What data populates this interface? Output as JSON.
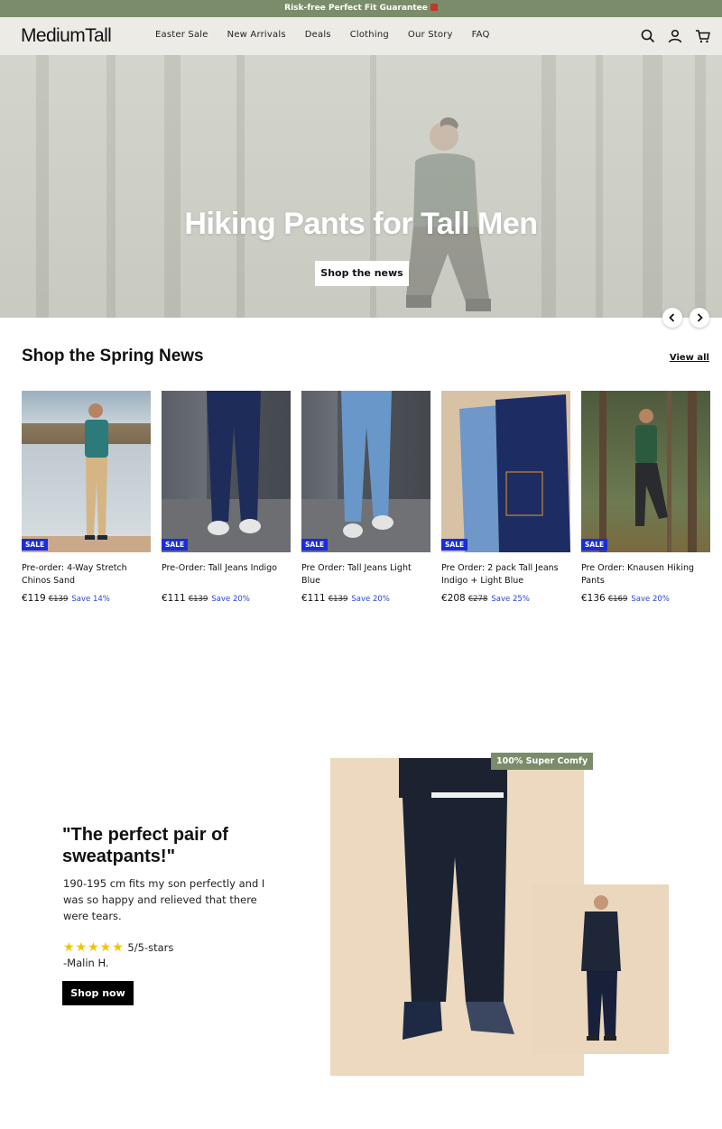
{
  "announcement": {
    "text": "Risk-free Perfect Fit Guarantee"
  },
  "header": {
    "logo": "MediumTall",
    "nav": [
      "Easter Sale",
      "New Arrivals",
      "Deals",
      "Clothing",
      "Our Story",
      "FAQ"
    ],
    "icons": [
      "search-icon",
      "account-icon",
      "cart-icon"
    ]
  },
  "hero": {
    "title": "Hiking Pants for Tall Men",
    "button": "Shop the news"
  },
  "spring": {
    "title": "Shop the Spring News",
    "view_all": "View all",
    "products": [
      {
        "badge": "SALE",
        "name": "Pre-order: 4-Way Stretch Chinos Sand",
        "price": "€119",
        "was": "€139",
        "save": "Save 14%"
      },
      {
        "badge": "SALE",
        "name": "Pre-Order: Tall Jeans Indigo",
        "price": "€111",
        "was": "€139",
        "save": "Save 20%"
      },
      {
        "badge": "SALE",
        "name": "Pre Order: Tall Jeans Light Blue",
        "price": "€111",
        "was": "€139",
        "save": "Save 20%"
      },
      {
        "badge": "SALE",
        "name": "Pre Order: 2 pack Tall Jeans Indigo + Light Blue",
        "price": "€208",
        "was": "€278",
        "save": "Save 25%"
      },
      {
        "badge": "SALE",
        "name": "Pre Order: Knausen Hiking Pants",
        "price": "€136",
        "was": "€169",
        "save": "Save 20%"
      }
    ]
  },
  "testimonial": {
    "quote": "\"The perfect pair of sweatpants!\"",
    "text": "190-195 cm fits my son perfectly and I was so happy and relieved that there were tears.",
    "stars": "★★★★★",
    "rating": "5/5-stars",
    "author": "-Malin H.",
    "button": "Shop now",
    "badge": "100% Super Comfy"
  },
  "colors": {
    "announcement_bg": "#7a8c6a",
    "header_bg": "#ecebe6",
    "sale_badge": "#1a2ed8",
    "save_text": "#2a46d6"
  }
}
